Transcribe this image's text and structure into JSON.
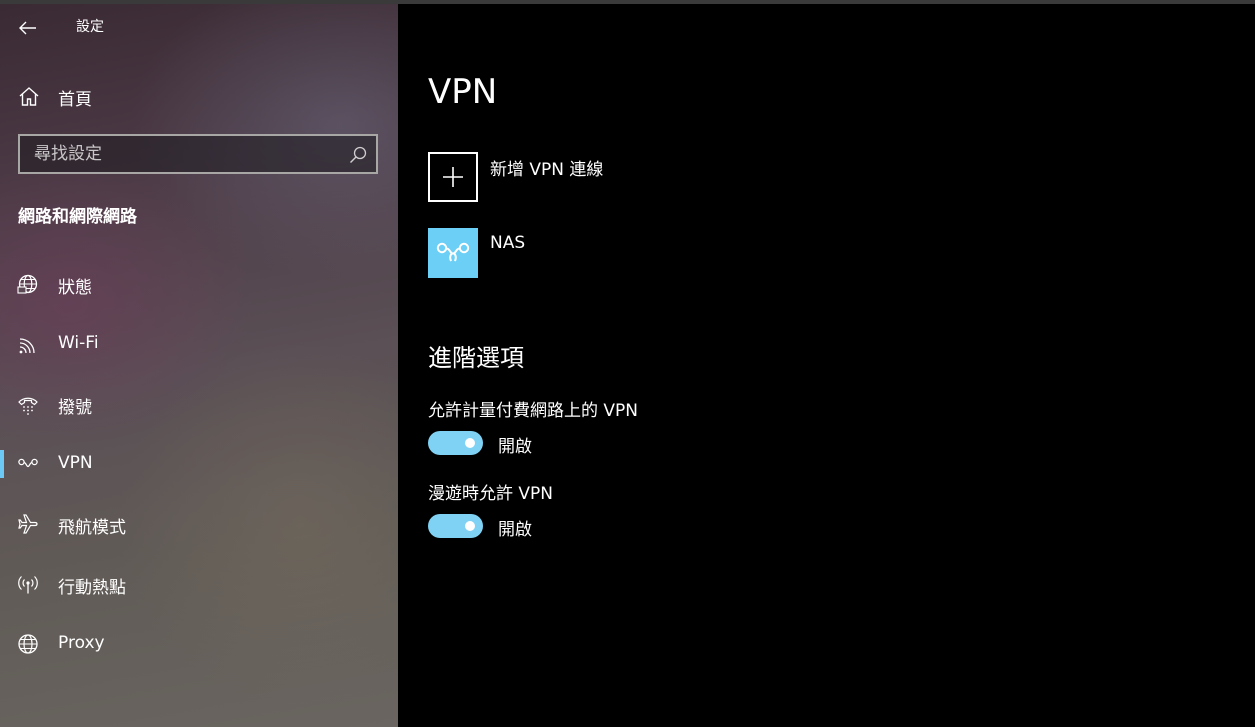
{
  "window": {
    "title": "設定"
  },
  "sidebar": {
    "home_label": "首頁",
    "search_placeholder": "尋找設定",
    "section_title": "網路和網際網路",
    "items": [
      {
        "label": "狀態",
        "icon": "globe-status-icon",
        "active": false
      },
      {
        "label": "Wi-Fi",
        "icon": "wifi-icon",
        "active": false
      },
      {
        "label": "撥號",
        "icon": "dialup-icon",
        "active": false
      },
      {
        "label": "VPN",
        "icon": "vpn-icon",
        "active": true
      },
      {
        "label": "飛航模式",
        "icon": "airplane-icon",
        "active": false
      },
      {
        "label": "行動熱點",
        "icon": "hotspot-icon",
        "active": false
      },
      {
        "label": "Proxy",
        "icon": "globe-icon",
        "active": false
      }
    ]
  },
  "main": {
    "title": "VPN",
    "add_vpn_label": "新增 VPN 連線",
    "connections": [
      {
        "name": "NAS",
        "icon": "vpn-connection-icon"
      }
    ],
    "advanced_title": "進階選項",
    "options": [
      {
        "label": "允許計量付費網路上的 VPN",
        "state": "開啟",
        "on": true
      },
      {
        "label": "漫遊時允許 VPN",
        "state": "開啟",
        "on": true
      }
    ]
  },
  "colors": {
    "accent": "#6cc9f5",
    "tile": "#6ccff6",
    "toggle_on": "#7fd2f4",
    "background": "#000000"
  }
}
